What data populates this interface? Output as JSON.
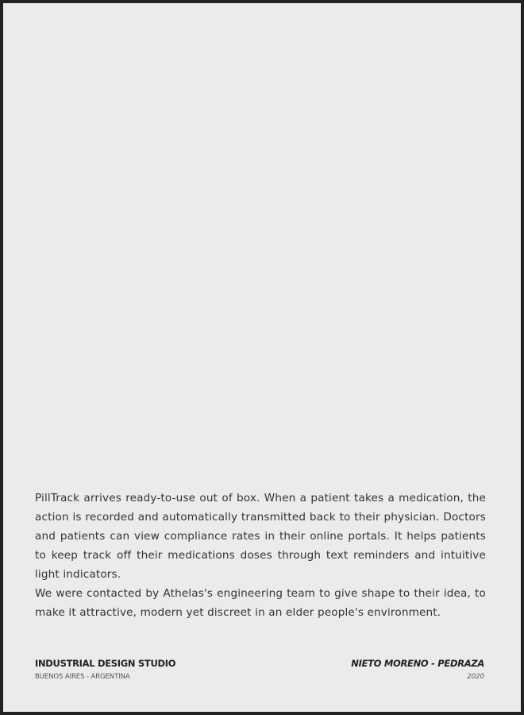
{
  "description": {
    "paragraph_1": "PillTrack arrives ready-to-use out of box. When a patient takes a medication, the action is recorded and automatically transmitted back to their physician. Doctors and patients can view compliance rates in their online portals. It helps patients to keep track off their medications doses through text reminders and intuitive light indicators.",
    "paragraph_2": "We were contacted by Athelas's engineering team to give shape to their idea, to make it attractive, modern yet discreet in an elder people's environment."
  },
  "footer": {
    "studio_name": "INDUSTRIAL DESIGN STUDIO",
    "location": "BUENOS AIRES  - ARGENTINA",
    "authors": "NIETO MORENO - PEDRAZA",
    "year": "2020"
  }
}
